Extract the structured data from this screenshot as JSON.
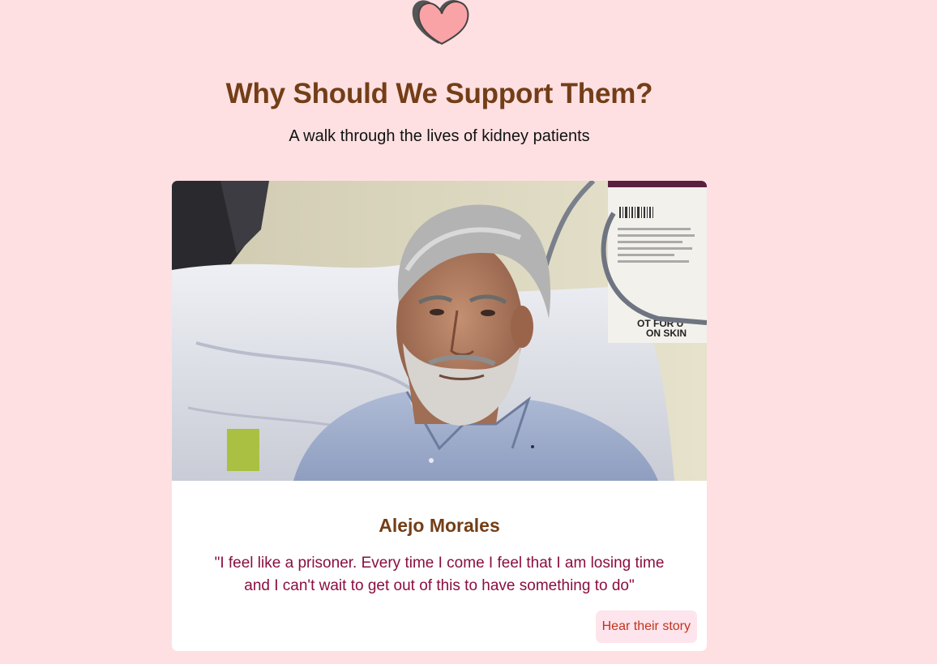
{
  "header": {
    "logo_icon": "heart-icon",
    "title": "Why Should We Support Them?",
    "subtitle": "A walk through the lives of kidney patients"
  },
  "card": {
    "photo_icon": "patient-photo",
    "photo_sign_text": "NOT FOR USE ON SKIN",
    "name": "Alejo Morales",
    "quote": "\"I feel like a prisoner. Every time I come I feel that I am losing time and I can't wait to get out of this to have something to do\"",
    "button_label": "Hear their story"
  },
  "colors": {
    "page_background": "#fee0e2",
    "heading": "#733e17",
    "quote": "#8a0e40",
    "button_text": "#c0341c",
    "button_background": "#fee4ec",
    "heart_fill": "#f9a3a6"
  }
}
